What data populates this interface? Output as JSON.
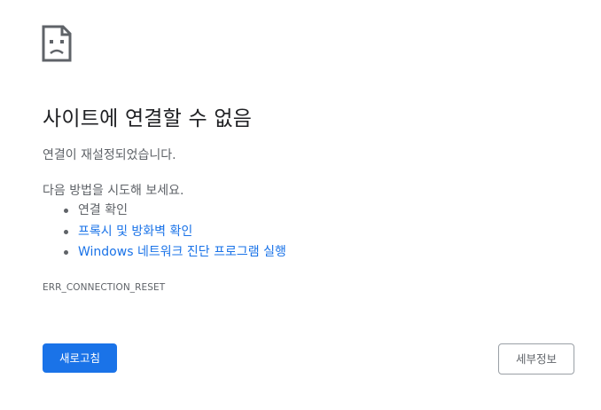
{
  "error_page": {
    "icon": "sad-page-icon",
    "title": "사이트에 연결할 수 없음",
    "subtitle": "연결이 재설정되었습니다.",
    "suggestions_heading": "다음 방법을 시도해 보세요.",
    "suggestions": [
      {
        "label": "연결 확인",
        "is_link": false
      },
      {
        "label": "프록시 및 방화벽 확인",
        "is_link": true
      },
      {
        "label": "Windows 네트워크 진단 프로그램 실행",
        "is_link": true
      }
    ],
    "error_code": "ERR_CONNECTION_RESET",
    "reload_label": "새로고침",
    "details_label": "세부정보"
  },
  "colors": {
    "primary": "#1a73e8",
    "text": "#5f6368",
    "title": "#202124"
  }
}
